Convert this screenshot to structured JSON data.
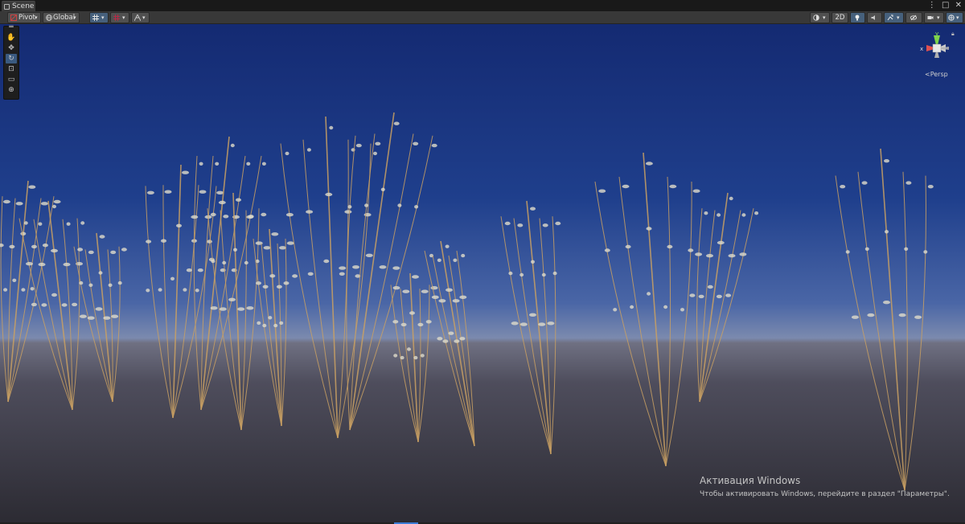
{
  "window": {
    "tab_label": "Scene",
    "window_icons": [
      "⋮",
      "□",
      "✕"
    ]
  },
  "toolbar": {
    "pivot_label": "Pivot",
    "global_label": "Global",
    "twod_label": "2D"
  },
  "gizmo": {
    "y_label": "y",
    "x_label": "x",
    "projection_label": "Persp"
  },
  "activation": {
    "title": "Активация Windows",
    "subtitle": "Чтобы активировать Windows, перейдите в раздел \"Параметры\"."
  },
  "colors": {
    "sky_top": "#16307a",
    "sky_horizon": "#7a8aae",
    "ground": "#2e2e34",
    "stem": "#c9a063",
    "flower_head": "#e0dccb",
    "active_blue": "#46607c",
    "axis_x": "#e05050",
    "axis_y": "#7ed34b"
  },
  "icons": [
    "scene-tab-icon",
    "pivot-icon",
    "global-icon",
    "grid-snap-icon",
    "snap-increment-icon",
    "wireframe-icon",
    "shading-icon",
    "lighting-icon",
    "audio-icon",
    "effects-icon",
    "visibility-icon",
    "camera-icon",
    "gizmos-icon",
    "hand-icon",
    "move-icon",
    "rotate-icon",
    "scale-icon",
    "rect-icon",
    "transform-icon",
    "lock-icon"
  ]
}
